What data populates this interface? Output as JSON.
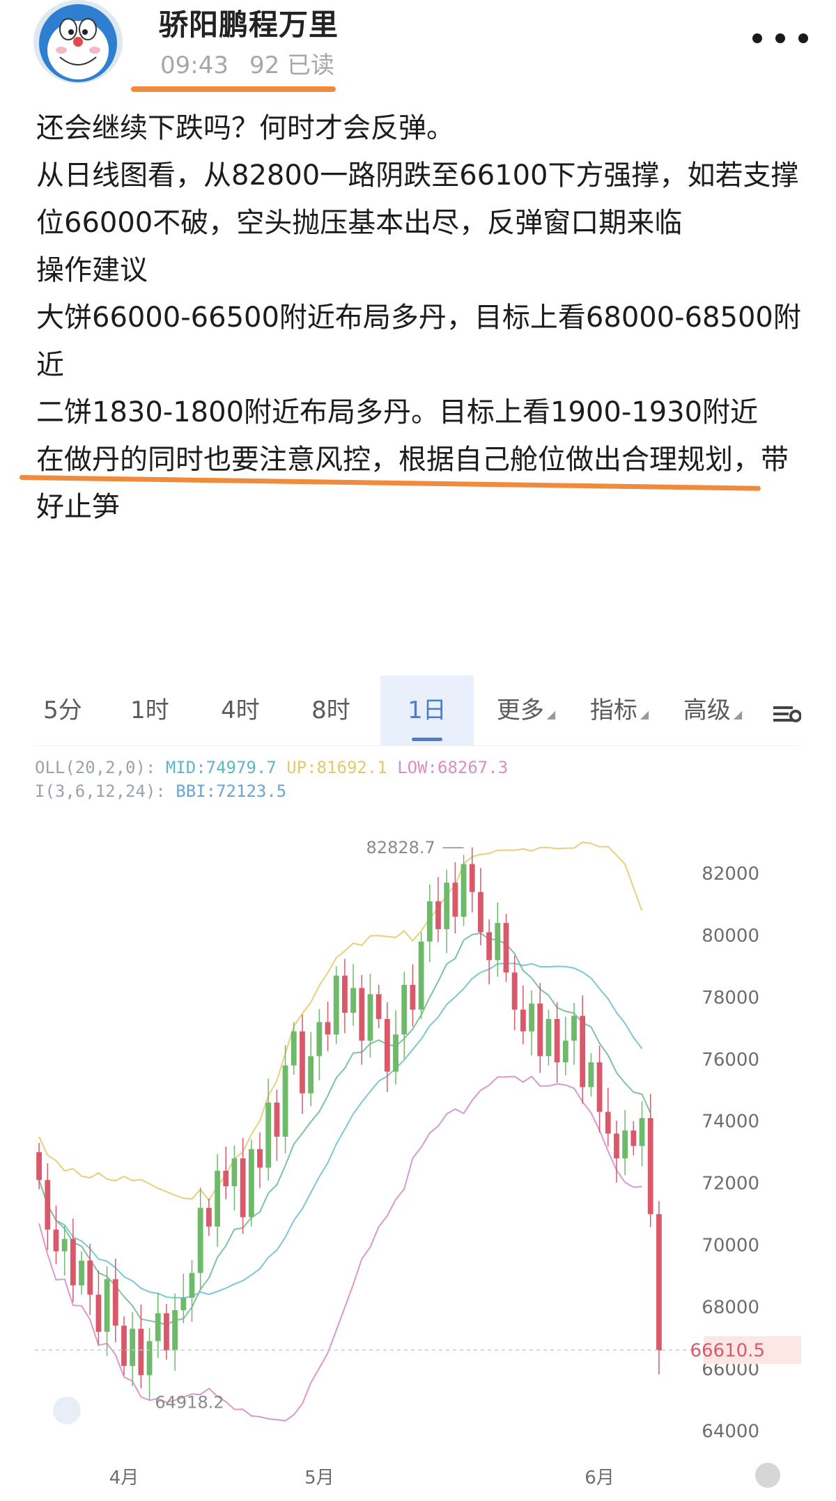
{
  "header": {
    "author": "骄阳鹏程万里",
    "time": "09:43",
    "reads": "92 已读"
  },
  "post": {
    "lines": [
      "还会继续下跌吗？何时才会反弹。",
      "从日线图看，从82800一路阴跌至66100下方强撑，如若支撑位66000不破，空头抛压基本出尽，反弹窗口期来临",
      "操作建议",
      "大饼66000-66500附近布局多丹，目标上看68000-68500附近",
      "二饼1830-1800附近布局多丹。目标上看1900-1930附近",
      "在做丹的同时也要注意风控，根据自己舱位做出合理规划，带好止笋"
    ]
  },
  "chart": {
    "tabs": [
      {
        "label": "5分",
        "active": false
      },
      {
        "label": "1时",
        "active": false
      },
      {
        "label": "4时",
        "active": false
      },
      {
        "label": "8时",
        "active": false
      },
      {
        "label": "1日",
        "active": true
      },
      {
        "label": "更多",
        "active": false
      },
      {
        "label": "指标",
        "active": false
      },
      {
        "label": "高级",
        "active": false
      }
    ],
    "boll": {
      "prefix": "OLL(20,2,0):",
      "mid": "MID:74979.7",
      "up": "UP:81692.1",
      "low": "LOW:68267.3"
    },
    "bbi": {
      "prefix": "I(3,6,12,24):",
      "value": "BBI:72123.5"
    },
    "high_label": "82828.7",
    "low_label": "64918.2",
    "last_price": "66610.5",
    "colors": {
      "up": "#6fba6a",
      "down": "#d9596b",
      "upper_band": "#e7cf7c",
      "mid_band": "#7cc7d6",
      "bbi": "#7fc39a",
      "lower_band": "#d69acb",
      "accent": "#4e7cc8",
      "underline": "#f08a3c"
    }
  },
  "chart_data": {
    "type": "candlestick",
    "y_ticks": [
      82000,
      80000,
      78000,
      76000,
      74000,
      72000,
      70000,
      68000,
      66000,
      64000
    ],
    "x_ticks": [
      "4月",
      "5月",
      "6月"
    ],
    "ylim": [
      63200,
      84000
    ],
    "annotations": {
      "high": 82828.7,
      "low": 64918.2,
      "last": 66610.5
    },
    "closes": [
      72100,
      70500,
      69800,
      70200,
      68700,
      69500,
      68400,
      67200,
      68900,
      67400,
      66100,
      67300,
      65800,
      66900,
      67800,
      66600,
      67900,
      68300,
      69100,
      71200,
      70600,
      72400,
      71900,
      72800,
      70900,
      73100,
      72500,
      74600,
      73500,
      75800,
      76900,
      74900,
      76100,
      77200,
      76800,
      78700,
      77500,
      78300,
      76600,
      78100,
      77300,
      75600,
      76800,
      78400,
      77600,
      79800,
      81100,
      80200,
      81700,
      80600,
      82300,
      81400,
      80100,
      79200,
      80400,
      78800,
      77600,
      76900,
      77800,
      76100,
      77300,
      75900,
      76600,
      77400,
      75100,
      75900,
      74300,
      73600,
      72800,
      73700,
      73200,
      74100,
      71000,
      66600
    ]
  }
}
